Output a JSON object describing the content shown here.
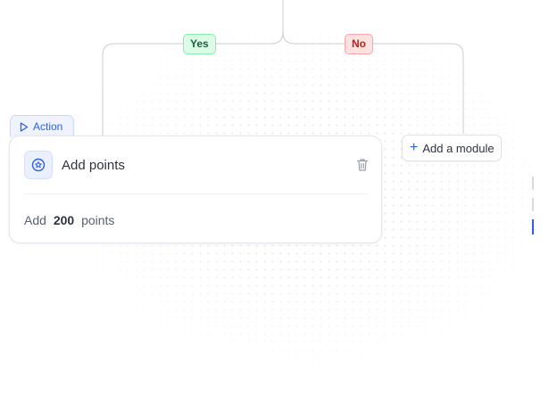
{
  "branches": {
    "yes_label": "Yes",
    "no_label": "No"
  },
  "action_node": {
    "tag_label": "Action",
    "title": "Add points",
    "description_prefix": "Add",
    "points_value": "200",
    "description_suffix": "points",
    "icon": "star-badge-icon",
    "delete_icon": "trash-icon"
  },
  "add_module": {
    "label": "Add a module",
    "icon": "plus-icon"
  },
  "colors": {
    "accent": "#2f5fe3",
    "yes_bg": "#dcfce7",
    "yes_text": "#166534",
    "no_bg": "#fee2e2",
    "no_text": "#b42318",
    "connector": "#c9cdd4"
  }
}
